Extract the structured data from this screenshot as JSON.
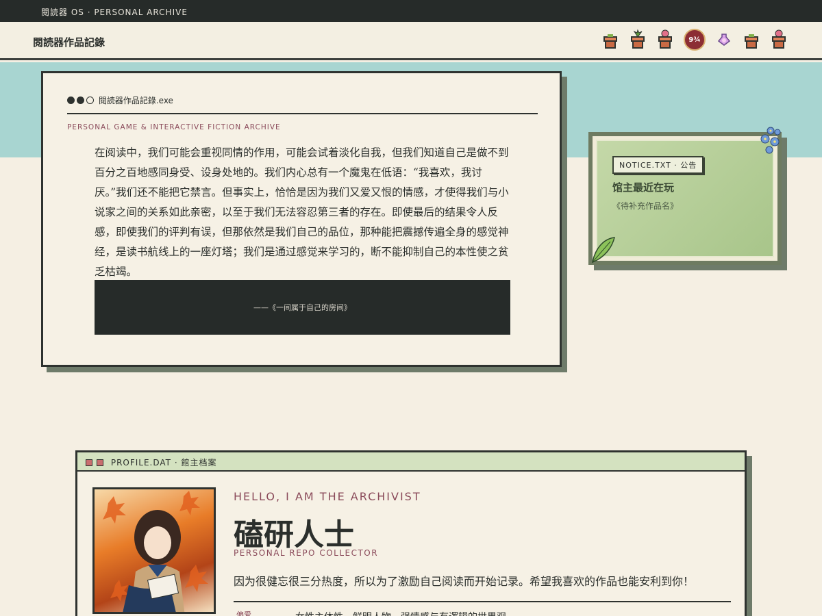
{
  "topbar": {
    "text": "閱読器 OS · PERSONAL ARCHIVE"
  },
  "header": {
    "title": "閱読器作品記錄",
    "badge_text": "9¾"
  },
  "main_window": {
    "title": "閱読器作品記錄.exe",
    "subtitle": "PERSONAL GAME & INTERACTIVE FICTION ARCHIVE",
    "quote": "在阅读中，我们可能会重视同情的作用，可能会试着淡化自我，但我们知道自己是做不到百分之百地感同身受、设身处地的。我们内心总有一个魔鬼在低语：“我喜欢，我讨厌。”我们还不能把它禁言。但事实上，恰恰是因为我们又爱又恨的情感，才使得我们与小说家之间的关系如此亲密，以至于我们无法容忍第三者的存在。即使最后的结果令人反感，即使我们的评判有误，但那依然是我们自己的品位，那种能把震撼传遍全身的感觉神经，是读书航线上的一座灯塔；我们是通过感觉来学习的，断不能抑制自己的本性使之贫乏枯竭。",
    "attribution": "——《一间属于自己的房间》"
  },
  "notice": {
    "tag": "NOTICE.TXT · 公告",
    "heading": "馆主最近在玩",
    "body": "《待补充作品名》"
  },
  "profile": {
    "titlebar": "PROFILE.DAT · 館主档案",
    "hello": "HELLO, I AM THE ARCHIVIST",
    "name": "磕研人士",
    "role": "PERSONAL REPO COLLECTOR",
    "description": "因为很健忘很三分热度，所以为了激励自己阅读而开始记录。希望我喜欢的作品也能安利到你！",
    "pref_label": "偏爱",
    "pref_value": "女性主体性、鲜明人物、强情感与有逻辑的世界观"
  },
  "colors": {
    "topbar_bg": "#262b29",
    "teal_band": "#a8d5d1",
    "accent_rose": "#8a4a5a",
    "notice_green": "#a8c58a",
    "shadow": "#6e7b6a"
  },
  "icons": [
    "potted-plant-icon",
    "sprout-pot-icon",
    "flower-pot-icon",
    "platform-badge-icon",
    "potion-icon",
    "potted-plant-icon",
    "flower-pot-icon"
  ]
}
